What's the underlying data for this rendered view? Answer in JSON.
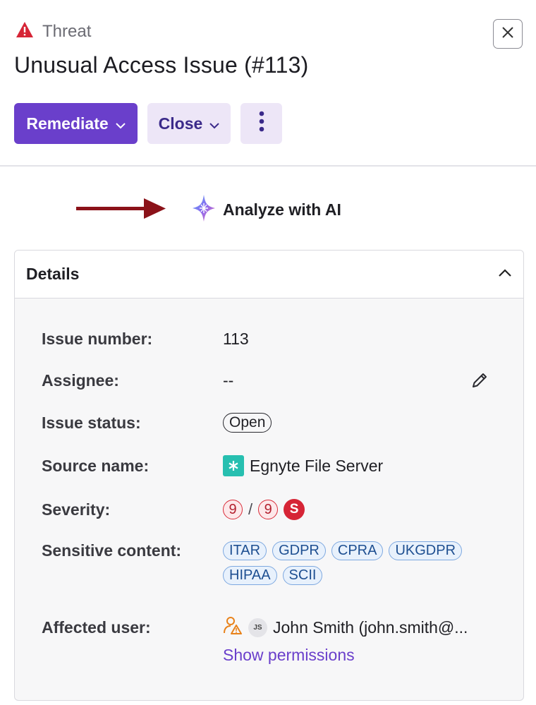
{
  "header": {
    "type_label": "Threat",
    "title": "Unusual Access Issue (#113)",
    "actions": {
      "remediate": "Remediate",
      "close": "Close"
    }
  },
  "ai": {
    "label": "Analyze with AI"
  },
  "details": {
    "title": "Details",
    "fields": {
      "issue_number": {
        "label": "Issue number:",
        "value": "113"
      },
      "assignee": {
        "label": "Assignee:",
        "value": "--"
      },
      "issue_status": {
        "label": "Issue status:",
        "value": "Open"
      },
      "source_name": {
        "label": "Source name:",
        "value": "Egnyte File Server"
      },
      "severity": {
        "label": "Severity:",
        "value_a": "9",
        "separator": "/",
        "value_b": "9",
        "badge": "S"
      },
      "sensitive_content": {
        "label": "Sensitive content:",
        "tags": [
          "ITAR",
          "GDPR",
          "CPRA",
          "UKGDPR",
          "HIPAA",
          "SCII"
        ]
      },
      "affected_user": {
        "label": "Affected user:",
        "initials": "JS",
        "name": "John Smith (john.smith@...",
        "link": "Show permissions"
      }
    }
  },
  "colors": {
    "accent": "#6a3fcb",
    "warning": "#d62536",
    "source_icon": "#27bfb0",
    "arrow": "#8b1219"
  },
  "icons": [
    "warning-triangle-icon",
    "close-icon",
    "chevron-down-icon",
    "more-vertical-icon",
    "ai-sparkle-icon",
    "arrow-right-icon",
    "chevron-up-icon",
    "edit-pencil-icon",
    "egnyte-icon",
    "user-alert-icon"
  ]
}
